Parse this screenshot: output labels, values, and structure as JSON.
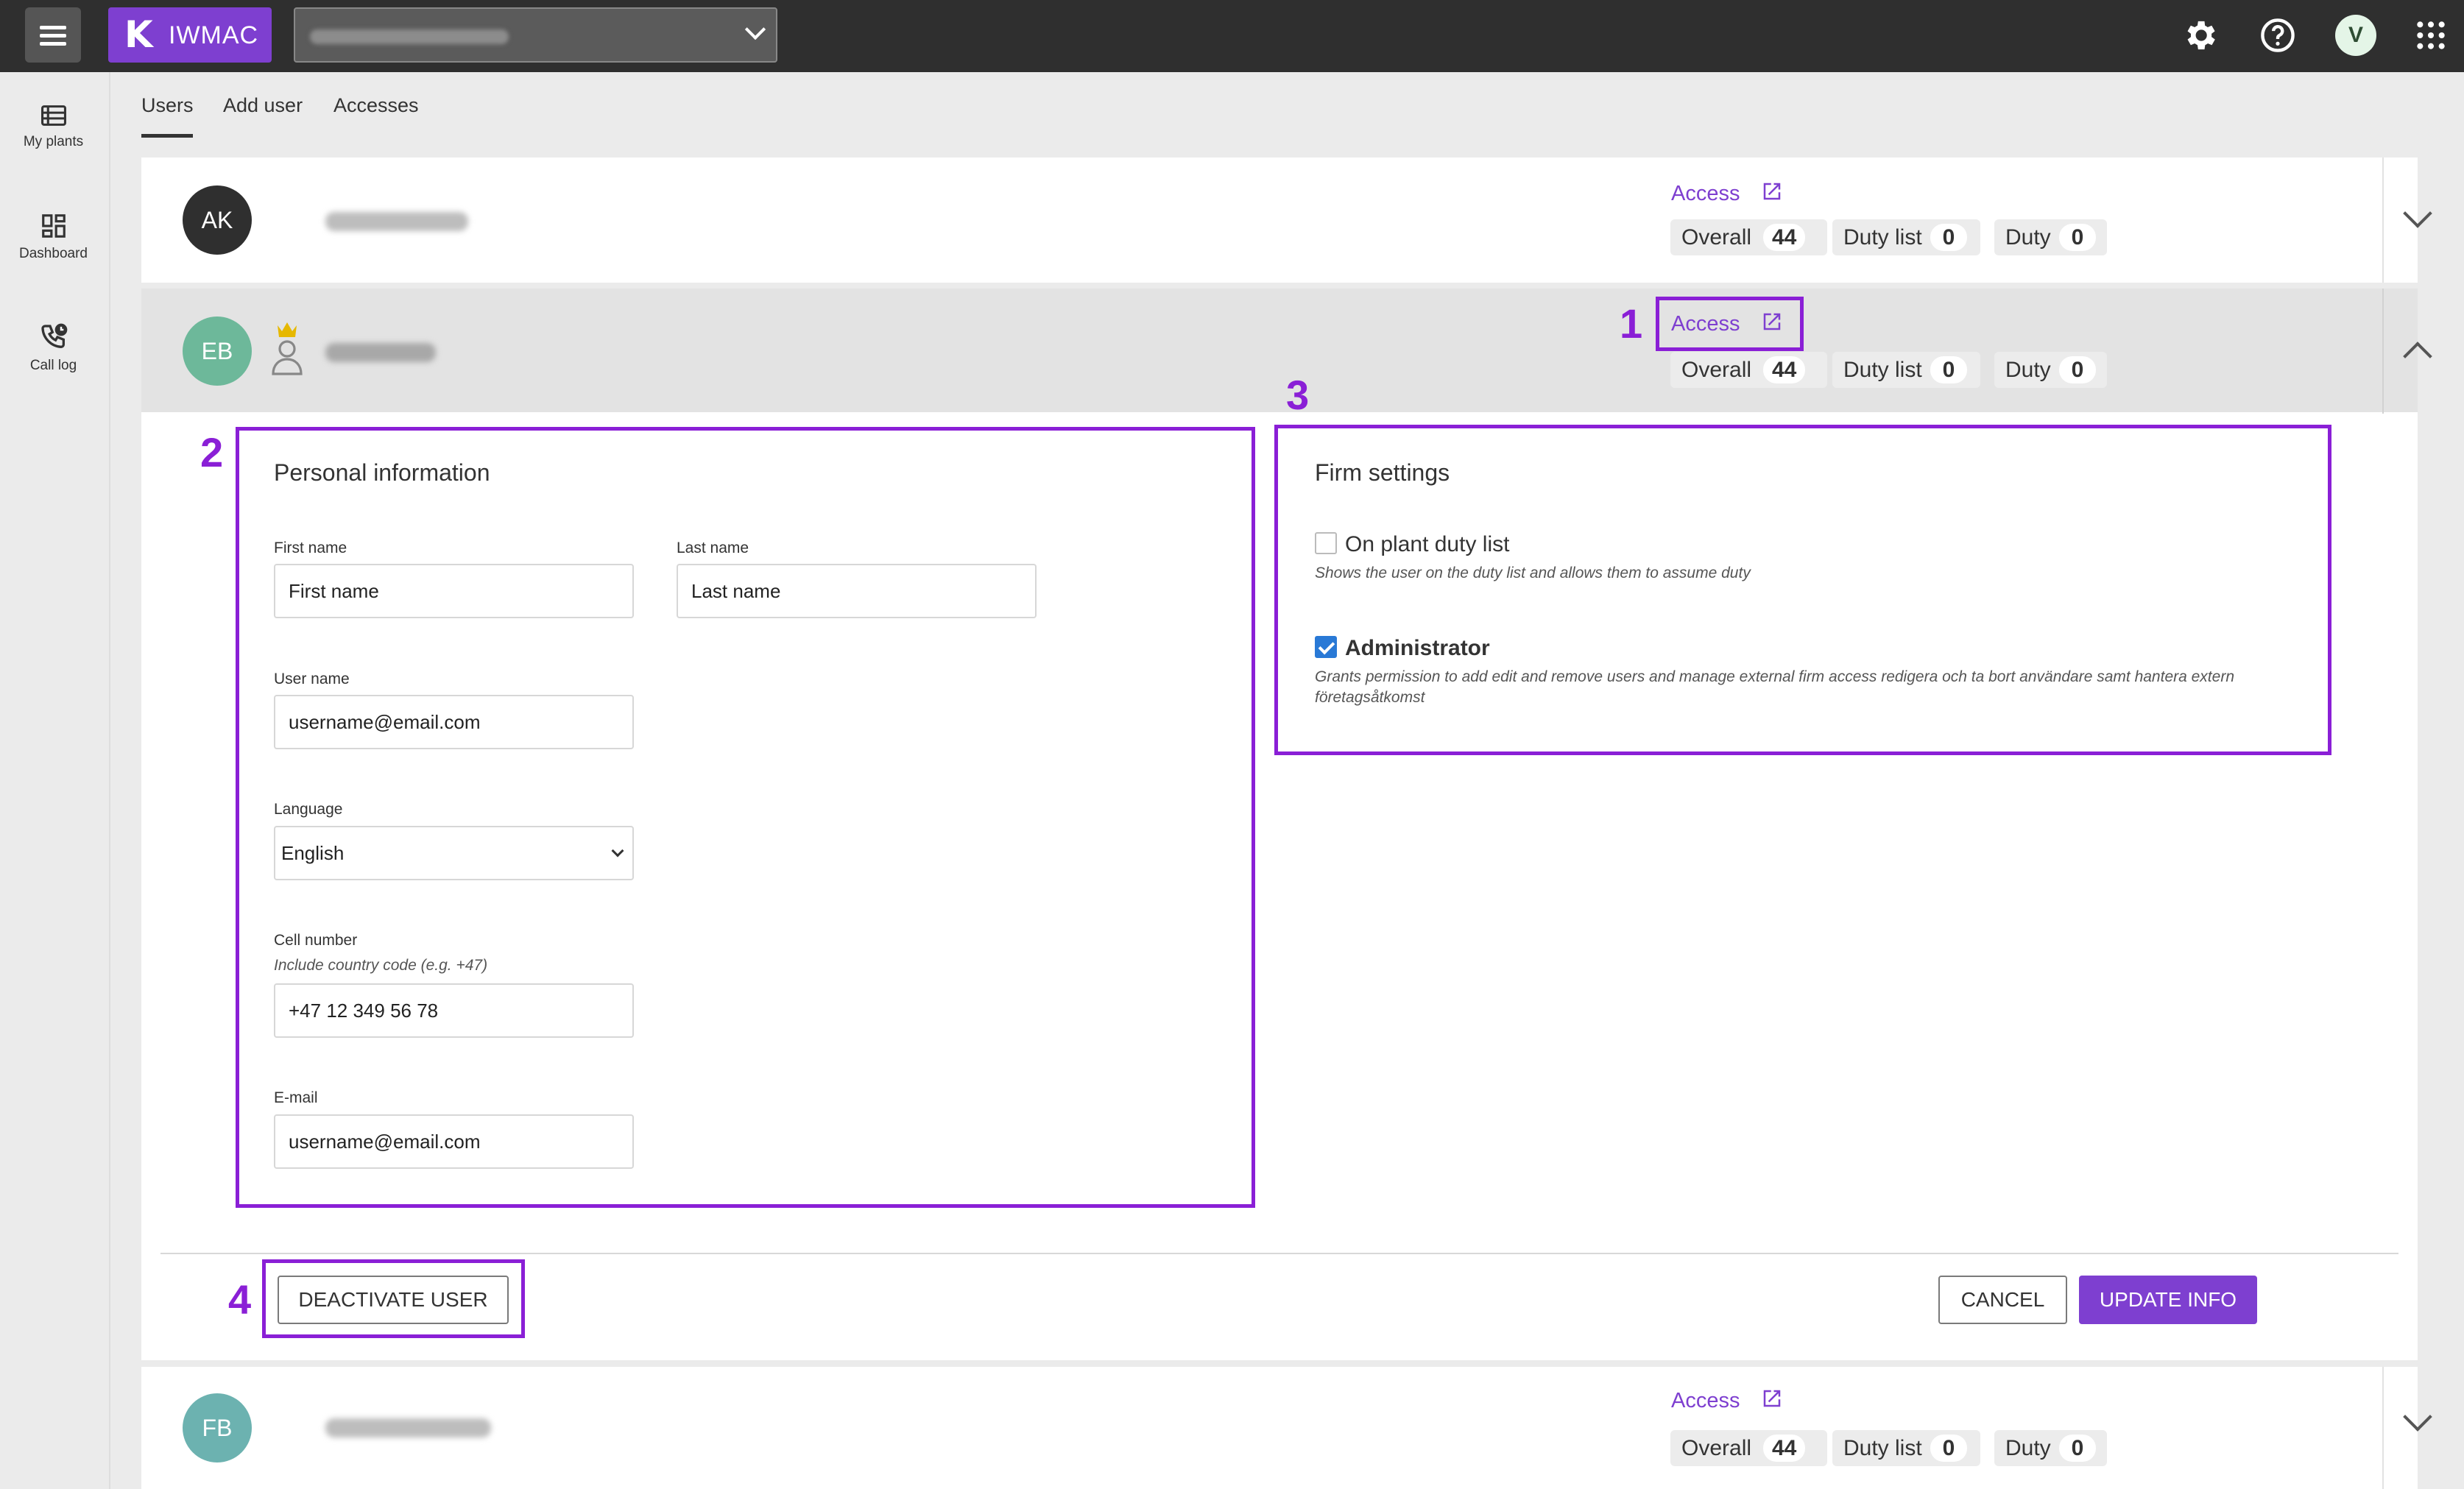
{
  "app": {
    "logo_text": "IWMAC"
  },
  "sidebar": {
    "items": [
      {
        "label": "My plants"
      },
      {
        "label": "Dashboard"
      },
      {
        "label": "Call log"
      }
    ]
  },
  "topbar": {
    "user_initial": "V"
  },
  "tabs": [
    {
      "label": "Users"
    },
    {
      "label": "Add user"
    },
    {
      "label": "Accesses"
    }
  ],
  "users": [
    {
      "initials": "AK",
      "avatar_color": "#2f2f2f",
      "access_label": "Access",
      "overall_label": "Overall",
      "overall": "44",
      "duty_list_label": "Duty list",
      "duty_list": "0",
      "duty_label": "Duty",
      "duty": "0"
    },
    {
      "initials": "EB",
      "avatar_color": "#6db89a",
      "access_label": "Access",
      "overall_label": "Overall",
      "overall": "44",
      "duty_list_label": "Duty list",
      "duty_list": "0",
      "duty_label": "Duty",
      "duty": "0"
    },
    {
      "initials": "FB",
      "avatar_color": "#6cb2b0",
      "access_label": "Access",
      "overall_label": "Overall",
      "overall": "44",
      "duty_list_label": "Duty list",
      "duty_list": "0",
      "duty_label": "Duty",
      "duty": "0"
    }
  ],
  "personal": {
    "title": "Personal information",
    "first_name_label": "First name",
    "first_name_value": "First name",
    "last_name_label": "Last name",
    "last_name_value": "Last name",
    "username_label": "User name",
    "username_value": "username@email.com",
    "language_label": "Language",
    "language_value": "English",
    "cell_label": "Cell number",
    "cell_hint": "Include country code (e.g.  +47)",
    "cell_value": "+47 12 349 56 78",
    "email_label": "E-mail",
    "email_value": "username@email.com"
  },
  "firm": {
    "title": "Firm settings",
    "duty_list_label": "On plant duty list",
    "duty_list_checked": false,
    "duty_list_desc": "Shows the user on the duty list and allows them to assume duty",
    "admin_label": "Administrator",
    "admin_checked": true,
    "admin_desc": "Grants permission to add  edit  and remove users and manage external firm access  redigera och ta bort användare samt hantera extern företagsåtkomst"
  },
  "actions": {
    "deactivate": "DEACTIVATE USER",
    "cancel": "CANCEL",
    "update": "UPDATE INFO"
  },
  "annotations": [
    "1",
    "2",
    "3",
    "4"
  ],
  "colors": {
    "accent": "#7e3fd0",
    "annotation": "#8a1fd6",
    "topbar": "#2f2f2f"
  }
}
